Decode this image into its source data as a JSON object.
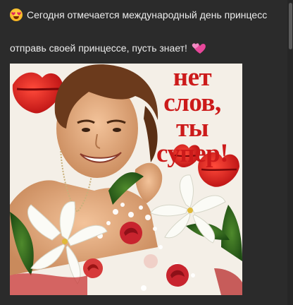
{
  "message": {
    "line1_emoji": "heart-eyes-emoji",
    "line1_text": "Сегодня отмечается международный день принцесс",
    "line2_text": "отправь своей принцессе, пусть знает!",
    "line2_emoji": "revolving-hearts-emoji"
  },
  "photo": {
    "caption_lines": [
      "нет",
      "слов,",
      "ты",
      "супер!"
    ]
  },
  "colors": {
    "background": "#2b2b2b",
    "text": "#ececec",
    "caption_red": "#cc1a1a"
  }
}
